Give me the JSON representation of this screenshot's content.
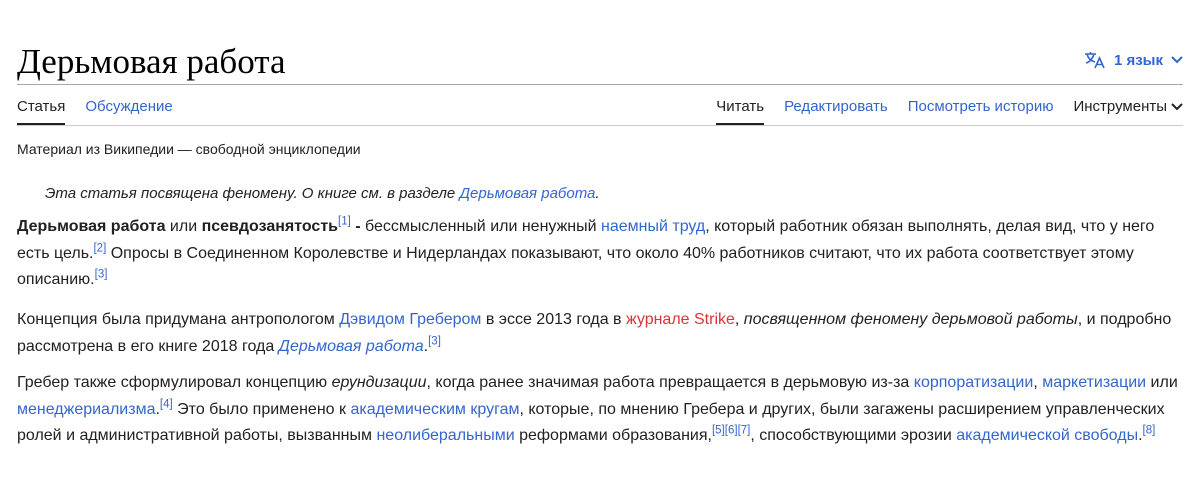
{
  "article": {
    "title": "Дерьмовая работа",
    "tagline": "Материал из Википедии — свободной энциклопедии"
  },
  "languages": {
    "label": "1 язык"
  },
  "tabs": {
    "article": "Статья",
    "talk": "Обсуждение",
    "read": "Читать",
    "edit": "Редактировать",
    "history": "Посмотреть историю",
    "tools": "Инструменты"
  },
  "hatnote": {
    "text": "Эта статья посвящена феномену. О книге см. в разделе ",
    "link": "Дерьмовая работа",
    "end": "."
  },
  "p1": {
    "term1": "Дерьмовая работа",
    "t1": " или ",
    "term2": "псевдозанятость",
    "ref1": "[1]",
    "dash": " - ",
    "t2": "бессмысленный или ненужный ",
    "link_labor": "наемный труд",
    "t3": ", который работник обязан выполнять, делая вид, что у него есть цель.",
    "ref2": "[2]",
    "t4": " Опросы в Соединенном Королевстве и Нидерландах показывают, что около 40% работников считают, что их работа соответствует этому описанию.",
    "ref3": "[3]"
  },
  "p2": {
    "t1": "Концепция была придумана антропологом ",
    "link_graeber": "Дэвидом Гребером",
    "t2": " в эссе 2013 года в ",
    "link_strike": "журнале Strike",
    "t3": ", ",
    "essay": "посвященном феномену дерьмовой работы",
    "t4": ", и подробно рассмотрена в его книге 2018 года ",
    "link_book": "Дерьмовая работа",
    "t5": ".",
    "ref": "[3]"
  },
  "p3": {
    "t1": "Гребер также сформулировал концепцию ",
    "term": "ерундизации",
    "t2": ", когда ранее значимая работа превращается в дерьмовую из-за ",
    "link_corp": "корпоратизации",
    "comma": ",",
    "link_market": "маркетизации",
    "t3": " или ",
    "link_manag": "менеджериализма",
    "t3b": ".",
    "ref4": "[4]",
    "t4": " Это было применено к ",
    "link_acad": "академическим кругам",
    "t5": ", которые, по мнению Гребера и других, были загажены расширением управленческих ролей и административной работы, вызванным ",
    "link_neolib": "неолиберальными",
    "t6": " реформами образования,",
    "ref5": "[5]",
    "ref6": "[6]",
    "ref7": "[7]",
    "t7": ", способствующими эрозии ",
    "link_freedom": "академической свободы",
    "t8": ".",
    "ref8": "[8]"
  },
  "colors": {
    "link": "#3366cc",
    "redlink": "#dd3333",
    "text": "#202122"
  },
  "icons": {
    "language": "translate-icon",
    "tools": "chevron-down-icon"
  }
}
